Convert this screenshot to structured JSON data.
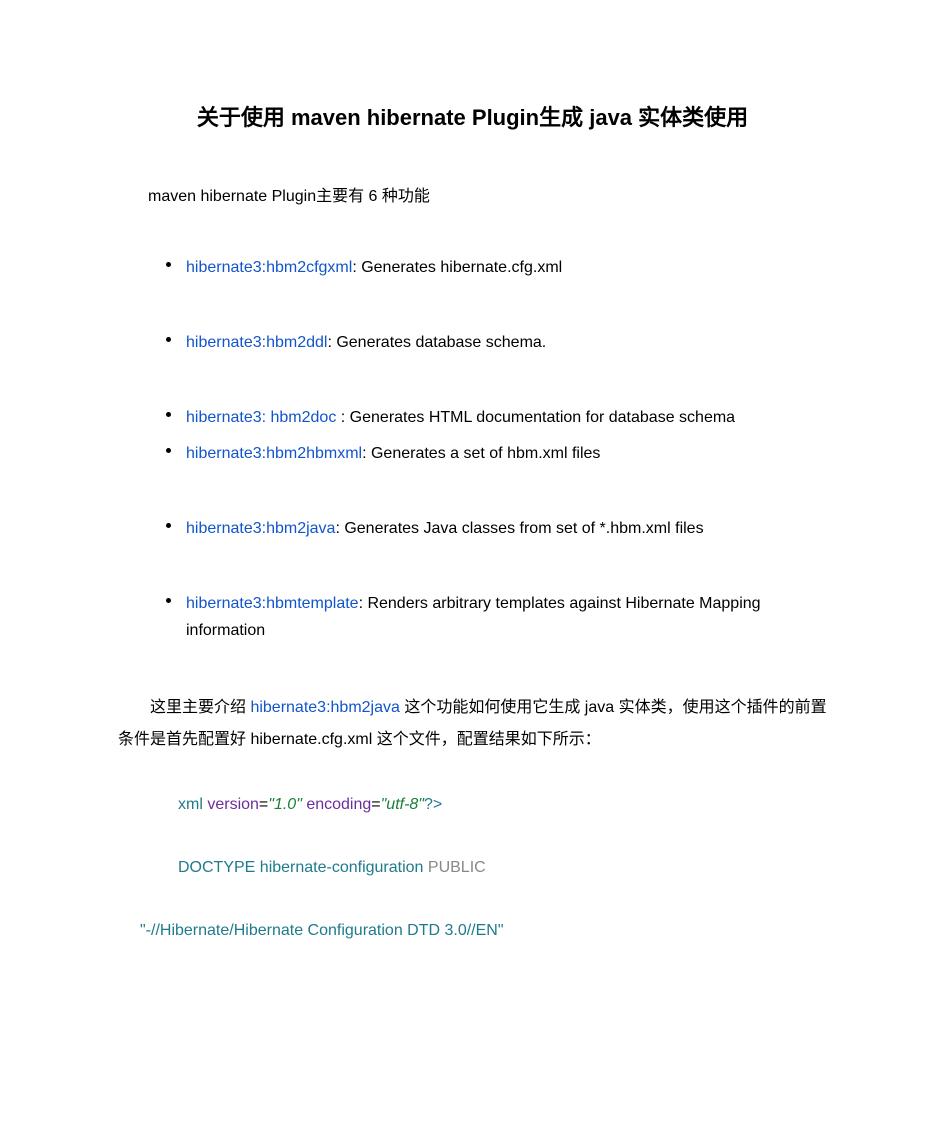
{
  "title": "关于使用 maven hibernate Plugin生成 java 实体类使用",
  "intro": "maven hibernate Plugin主要有 6 种功能",
  "bullets": [
    {
      "link": "hibernate3:hbm2cfgxml",
      "desc": ": Generates hibernate.cfg.xml"
    },
    {
      "link": "hibernate3:hbm2ddl",
      "desc": ": Generates database schema."
    },
    {
      "link": "hibernate3: hbm2doc ",
      "desc": ": Generates HTML documentation for database schema"
    },
    {
      "link": "hibernate3:hbm2hbmxml",
      "desc": ": Generates a set of hbm.xml files"
    },
    {
      "link": "hibernate3:hbm2java",
      "desc": ": Generates Java classes from set of *.hbm.xml files"
    },
    {
      "link": "hibernate3:hbmtemplate",
      "desc": ": Renders arbitrary templates against Hibernate Mapping information"
    }
  ],
  "para_prefix": "这里主要介绍 ",
  "para_link": "hibernate3:hbm2java",
  "para_suffix": " 这个功能如何使用它生成 java 实体类，使用这个插件的前置条件是首先配置好 hibernate.cfg.xml 这个文件，配置结果如下所示：",
  "xml": {
    "decl_xml": "xml",
    "decl_version_attr": " version",
    "decl_eq": "=",
    "decl_version_val": "\"1.0\"",
    "decl_encoding_attr": " encoding",
    "decl_encoding_val": "\"utf-8\"",
    "decl_end": "?>",
    "doctype_kw": "DOCTYPE",
    "doctype_name": " hibernate-configuration ",
    "doctype_public": "PUBLIC",
    "dtd_str": "\"-//Hibernate/Hibernate Configuration DTD 3.0//EN\""
  }
}
